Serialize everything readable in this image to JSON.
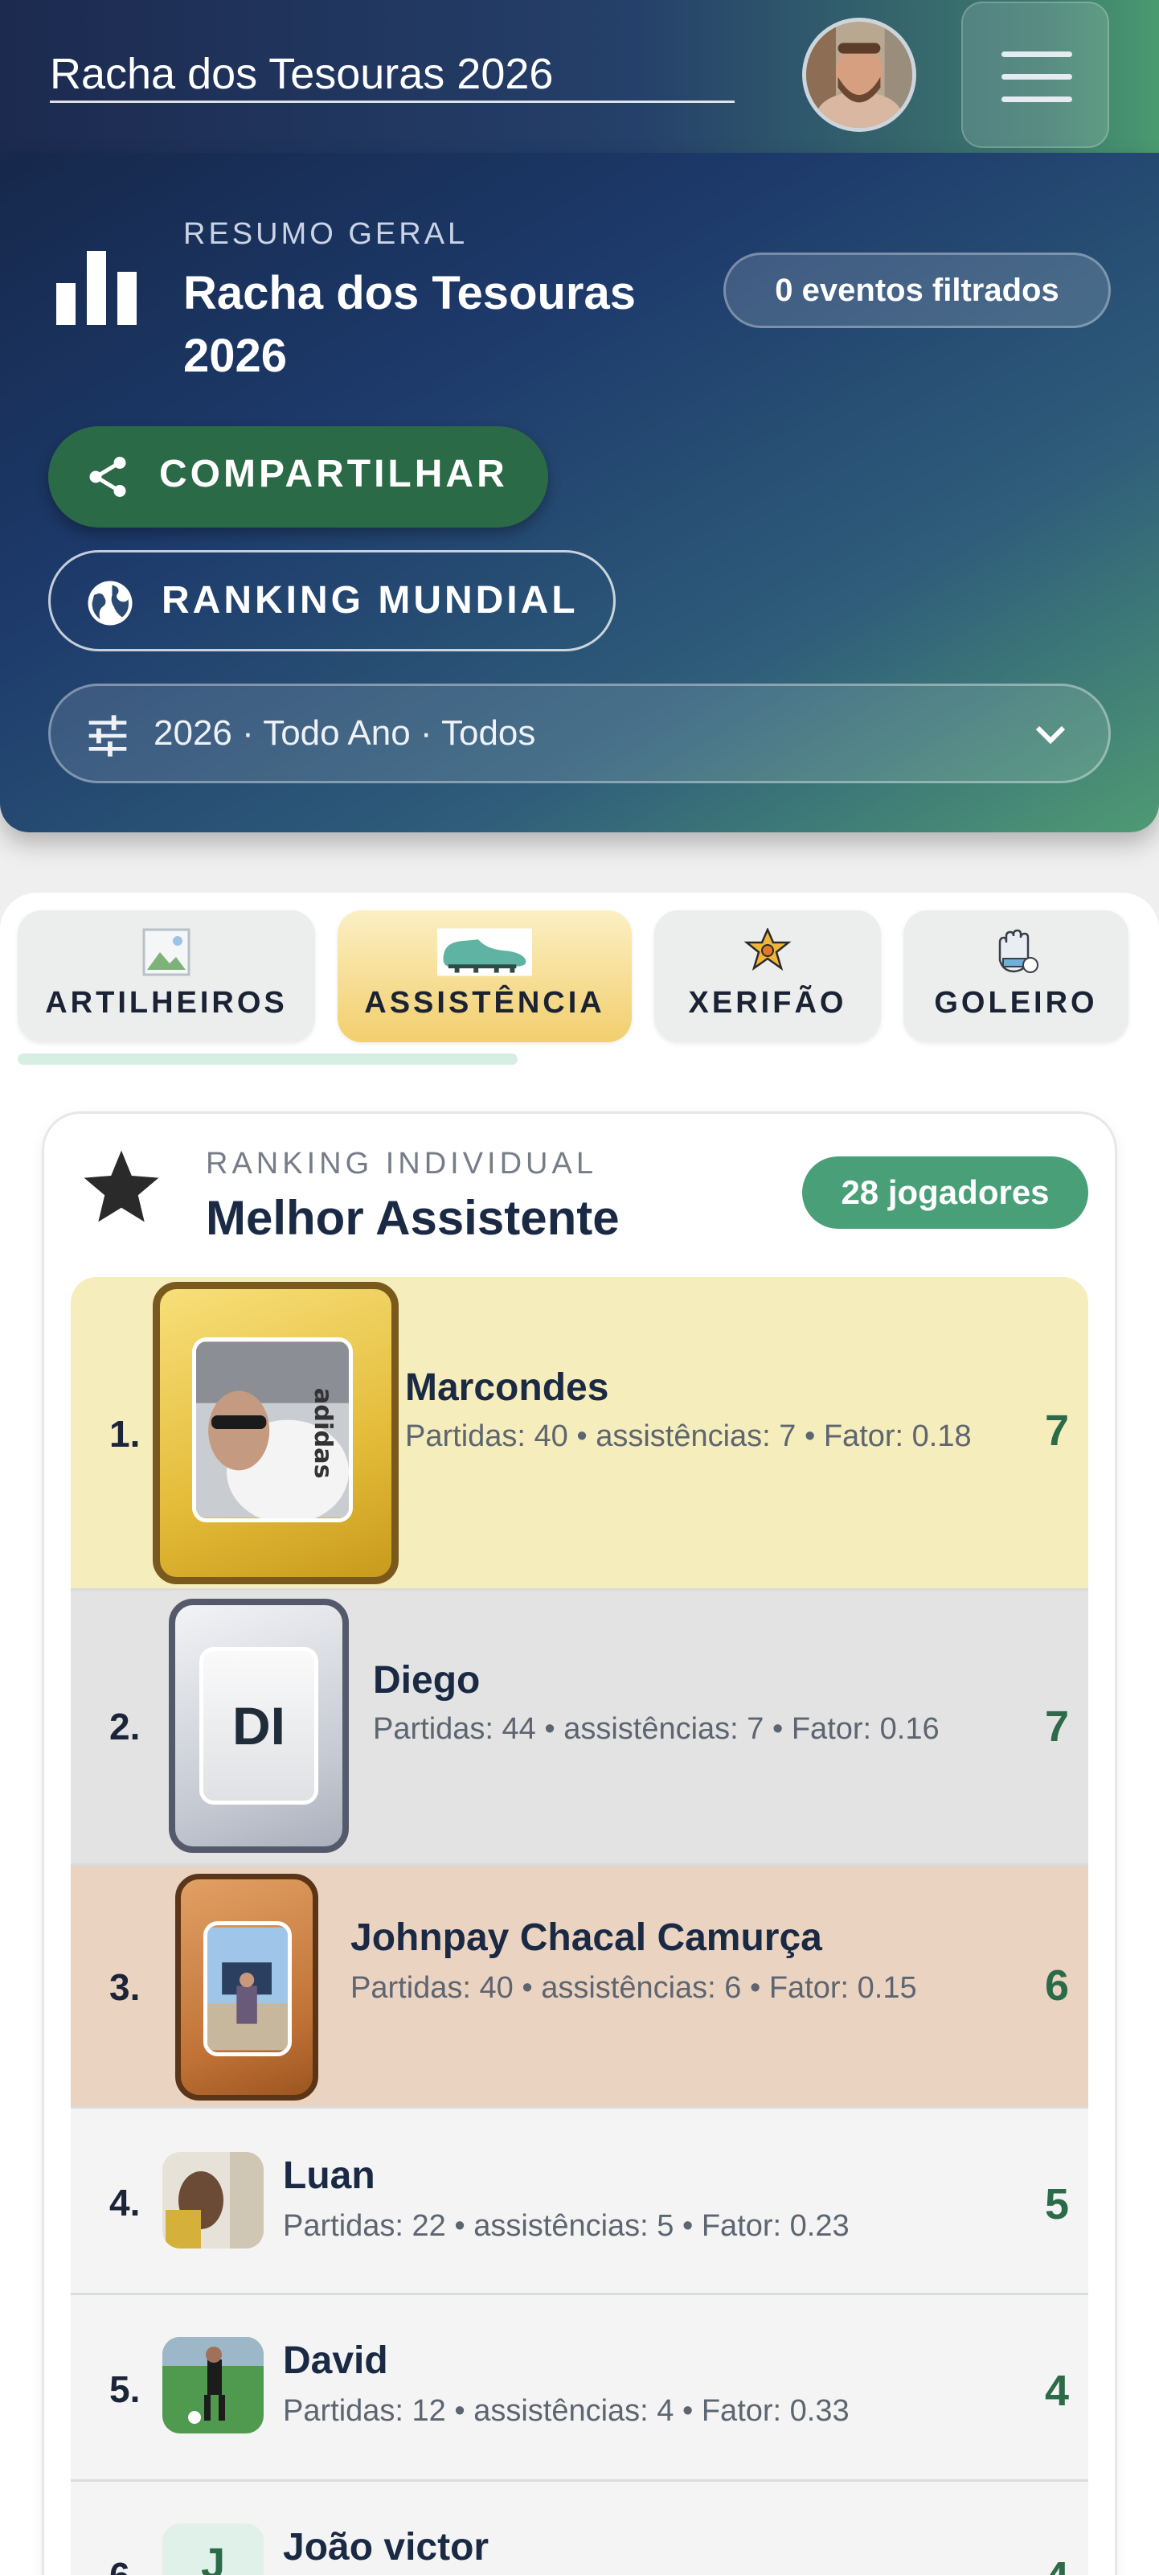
{
  "header": {
    "title": "Racha dos Tesouras 2026"
  },
  "summary": {
    "overline": "RESUMO GERAL",
    "title": "Racha dos Tesouras 2026",
    "events_badge": "0 eventos filtrados",
    "share_label": "COMPARTILHAR",
    "world_label": "RANKING MUNDIAL",
    "filter_value": "2026 · Todo Ano · Todos"
  },
  "tabs": [
    {
      "label": "ARTILHEIROS",
      "icon": "broken-image-icon",
      "active": false
    },
    {
      "label": "ASSISTÊNCIA",
      "icon": "soccer-cleat-icon",
      "active": true
    },
    {
      "label": "XERIFÃO",
      "icon": "sheriff-badge-icon",
      "active": false
    },
    {
      "label": "GOLEIRO",
      "icon": "goalkeeper-glove-icon",
      "active": false
    }
  ],
  "ranking": {
    "overline": "RANKING INDIVIDUAL",
    "title": "Melhor Assistente",
    "count_badge": "28 jogadores",
    "rows": [
      {
        "pos": "1.",
        "name": "Marcondes",
        "stats": "Partidas: 40 • assistências: 7 • Fator: 0.18",
        "score": "7"
      },
      {
        "pos": "2.",
        "name": "Diego",
        "initials": "DI",
        "stats": "Partidas: 44 • assistências: 7 • Fator: 0.16",
        "score": "7"
      },
      {
        "pos": "3.",
        "name": "Johnpay Chacal Camurça",
        "stats": "Partidas: 40 • assistências: 6 • Fator: 0.15",
        "score": "6"
      },
      {
        "pos": "4.",
        "name": "Luan",
        "stats": "Partidas: 22 • assistências: 5 • Fator: 0.23",
        "score": "5"
      },
      {
        "pos": "5.",
        "name": "David",
        "stats": "Partidas: 12 • assistências: 4 • Fator: 0.33",
        "score": "4"
      },
      {
        "pos": "6.",
        "name": "João victor",
        "score": "4"
      }
    ]
  },
  "colors": {
    "accent_green": "#2b6a46",
    "gold": "#f5edbb",
    "silver": "#e3e3e3",
    "bronze": "#ead4c1"
  }
}
